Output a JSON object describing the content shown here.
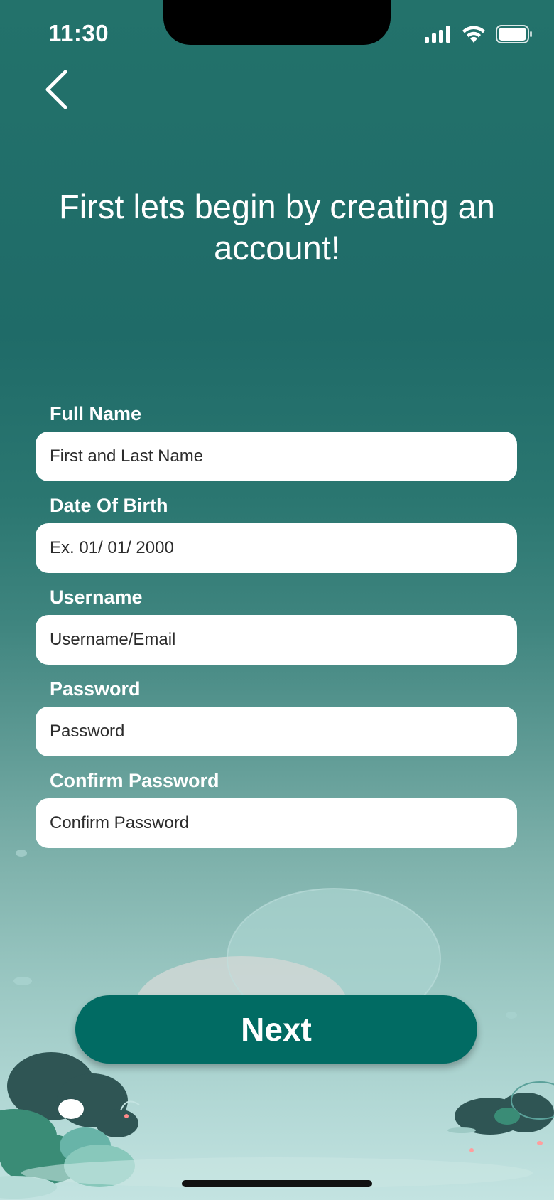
{
  "status_bar": {
    "time": "11:30",
    "icons": [
      "cellular-signal-icon",
      "wifi-icon",
      "battery-icon"
    ]
  },
  "header": {
    "back_icon": "chevron-left-icon",
    "title": "First lets begin by creating an account!"
  },
  "form": {
    "full_name": {
      "label": "Full Name",
      "placeholder": "First and Last Name",
      "value": ""
    },
    "date_of_birth": {
      "label": "Date Of Birth",
      "placeholder": "Ex. 01/ 01/ 2000",
      "value": ""
    },
    "username": {
      "label": "Username",
      "placeholder": "Username/Email",
      "value": ""
    },
    "password": {
      "label": "Password",
      "placeholder": "Password",
      "value": ""
    },
    "confirm_password": {
      "label": "Confirm Password",
      "placeholder": "Confirm Password",
      "value": ""
    }
  },
  "actions": {
    "next_label": "Next"
  },
  "colors": {
    "background_top": "#23726b",
    "background_bottom": "#c3e3e1",
    "button": "#016b63",
    "input_background": "#ffffff",
    "text_light": "#ffffff"
  }
}
